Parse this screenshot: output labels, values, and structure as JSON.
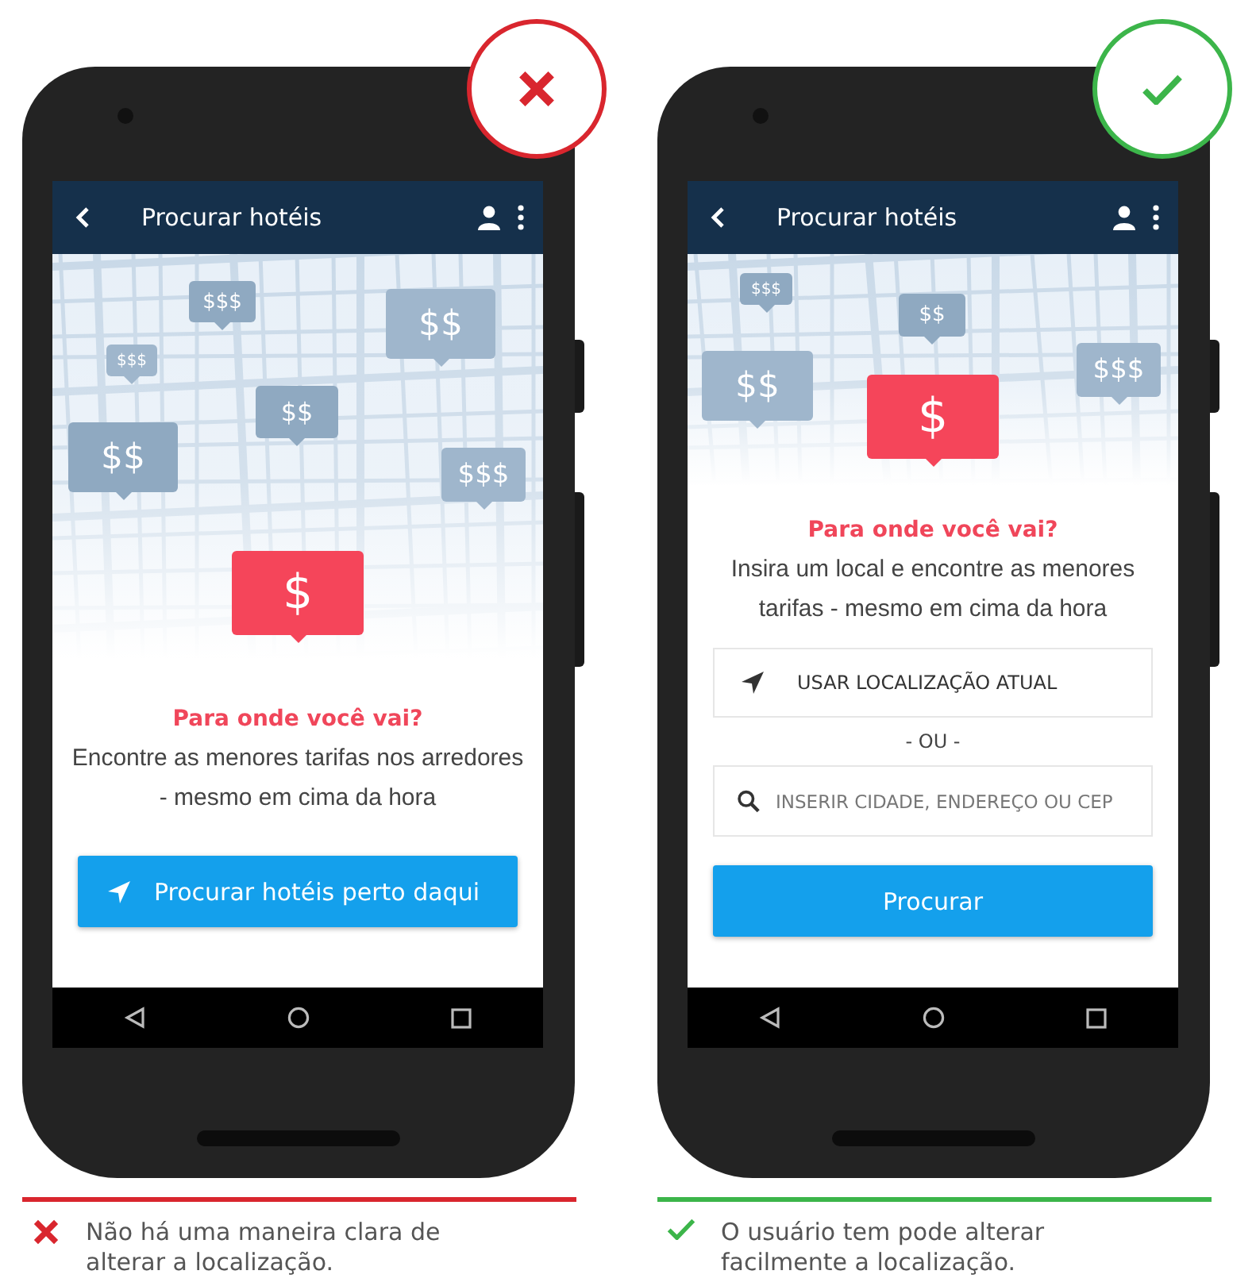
{
  "panels": [
    {
      "kind": "bad",
      "header": {
        "title": "Procurar hotéis"
      },
      "map_markers": [
        {
          "label": "$$$"
        },
        {
          "label": "$$$"
        },
        {
          "label": "$$"
        },
        {
          "label": "$$"
        },
        {
          "label": "$$"
        },
        {
          "label": "$$$"
        }
      ],
      "highlight_marker": "$",
      "heading": "Para onde você vai?",
      "description": "Encontre as menores tarifas nos arredores - mesmo em cima da hora",
      "controls": [
        {
          "kind": "nearby_button",
          "label": "Procurar hotéis perto daqui"
        }
      ],
      "caption": "Não há uma maneira clara de alterar a localização."
    },
    {
      "kind": "good",
      "header": {
        "title": "Procurar hotéis"
      },
      "map_markers": [
        {
          "label": "$$$"
        },
        {
          "label": "$$"
        },
        {
          "label": "$$"
        },
        {
          "label": "$$$"
        }
      ],
      "highlight_marker": "$",
      "heading": "Para onde você vai?",
      "description": "Insira um local e encontre as menores tarifas - mesmo em cima da hora",
      "controls": [
        {
          "kind": "location_option",
          "label": "USAR LOCALIZAÇÃO ATUAL"
        },
        {
          "kind": "separator",
          "label": "- OU -"
        },
        {
          "kind": "search_field",
          "placeholder": "INSERIR CIDADE, ENDEREÇO OU CEP"
        },
        {
          "kind": "button",
          "label": "Procurar"
        }
      ],
      "caption": "O usuário tem pode alterar facilmente a localização."
    }
  ]
}
